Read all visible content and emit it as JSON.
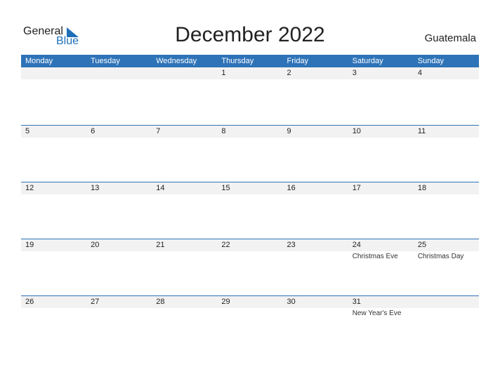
{
  "logo": {
    "general": "General",
    "blue": "Blue"
  },
  "title": "December 2022",
  "country": "Guatemala",
  "weekdays": [
    "Monday",
    "Tuesday",
    "Wednesday",
    "Thursday",
    "Friday",
    "Saturday",
    "Sunday"
  ],
  "weeks": [
    [
      {
        "d": ""
      },
      {
        "d": ""
      },
      {
        "d": ""
      },
      {
        "d": "1"
      },
      {
        "d": "2"
      },
      {
        "d": "3"
      },
      {
        "d": "4"
      }
    ],
    [
      {
        "d": "5"
      },
      {
        "d": "6"
      },
      {
        "d": "7"
      },
      {
        "d": "8"
      },
      {
        "d": "9"
      },
      {
        "d": "10"
      },
      {
        "d": "11"
      }
    ],
    [
      {
        "d": "12"
      },
      {
        "d": "13"
      },
      {
        "d": "14"
      },
      {
        "d": "15"
      },
      {
        "d": "16"
      },
      {
        "d": "17"
      },
      {
        "d": "18"
      }
    ],
    [
      {
        "d": "19"
      },
      {
        "d": "20"
      },
      {
        "d": "21"
      },
      {
        "d": "22"
      },
      {
        "d": "23"
      },
      {
        "d": "24",
        "h": "Christmas Eve"
      },
      {
        "d": "25",
        "h": "Christmas Day"
      }
    ],
    [
      {
        "d": "26"
      },
      {
        "d": "27"
      },
      {
        "d": "28"
      },
      {
        "d": "29"
      },
      {
        "d": "30"
      },
      {
        "d": "31",
        "h": "New Year's Eve"
      },
      {
        "d": ""
      }
    ]
  ]
}
